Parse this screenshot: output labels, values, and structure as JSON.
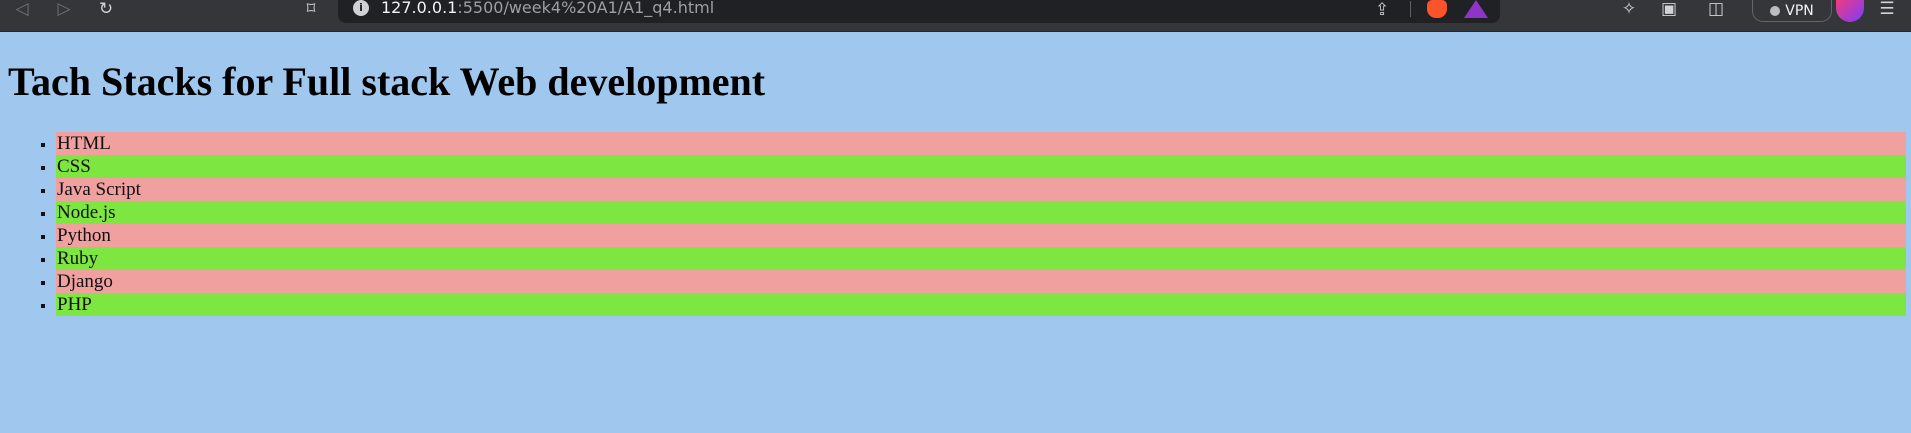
{
  "browser": {
    "url_host": "127.0.0.1",
    "url_path": ":5500/week4%20A1/A1_q4.html",
    "vpn_label": "VPN",
    "icons": {
      "back": "back-arrow-icon",
      "forward": "forward-arrow-icon",
      "reload": "reload-icon",
      "bookmark": "bookmark-icon",
      "info": "info-icon",
      "share": "share-icon",
      "brave": "brave-shield-icon",
      "rewards": "brave-rewards-icon",
      "extensions": "puzzle-piece-icon",
      "sidebar": "sidebar-icon",
      "wallet": "wallet-icon",
      "menu": "hamburger-menu-icon"
    }
  },
  "page": {
    "heading": "Tach Stacks for Full stack Web development",
    "items": [
      "HTML",
      "CSS",
      "Java Script",
      "Node.js",
      "Python",
      "Ruby",
      "Django",
      "PHP"
    ]
  },
  "colors": {
    "page_background": "#a0c8ee",
    "row_odd": "#efa09f",
    "row_even": "#7de640",
    "browser_chrome": "#35363a",
    "address_bar": "#202124"
  }
}
